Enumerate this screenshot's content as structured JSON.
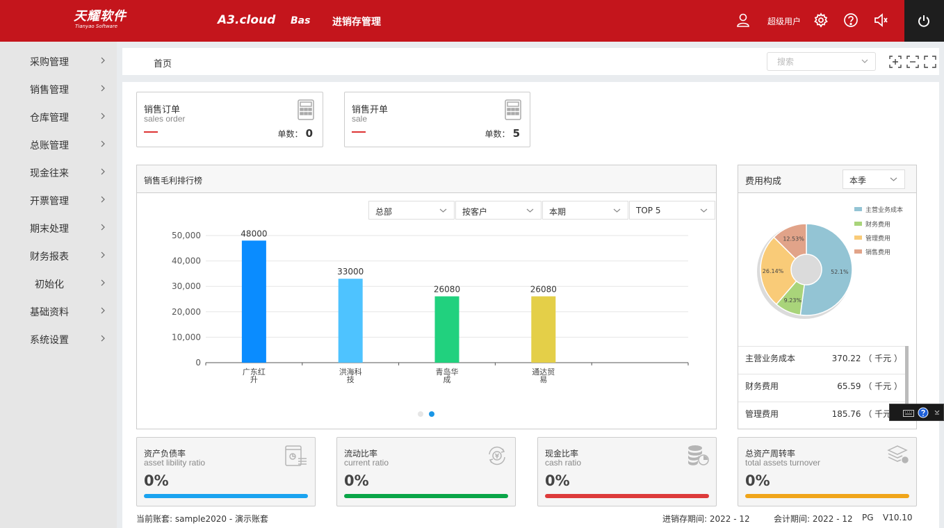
{
  "header": {
    "logo_cn": "天耀软件",
    "logo_en": "Tianyao Software",
    "nav": [
      "A3.cloud",
      "Bas",
      "进销存管理"
    ],
    "user_label": "超级用户",
    "icons": [
      "user-icon",
      "gear-icon",
      "help-icon",
      "speaker-icon",
      "power-icon"
    ]
  },
  "sidebar": {
    "items": [
      {
        "label": "采购管理"
      },
      {
        "label": "销售管理"
      },
      {
        "label": "仓库管理"
      },
      {
        "label": "总账管理"
      },
      {
        "label": "现金往来"
      },
      {
        "label": "开票管理"
      },
      {
        "label": "期末处理"
      },
      {
        "label": "财务报表"
      },
      {
        "label": "初始化"
      },
      {
        "label": "基础资料"
      },
      {
        "label": "系统设置"
      }
    ]
  },
  "breadcrumb": {
    "home": "首页"
  },
  "search": {
    "placeholder": "搜索"
  },
  "cards": [
    {
      "title": "销售订单",
      "subtitle": "sales order",
      "count_label": "单数：",
      "count": "0"
    },
    {
      "title": "销售开单",
      "subtitle": "sale",
      "count_label": "单数：",
      "count": "5"
    }
  ],
  "profit_panel": {
    "title": "销售毛利排行榜",
    "filters": [
      "总部",
      "按客户",
      "本期",
      "TOP 5"
    ]
  },
  "chart_data": {
    "type": "bar",
    "categories": [
      "广东红升",
      "洪海科技",
      "青岛华成",
      "通达贸易"
    ],
    "category_lines": [
      [
        "广东红",
        "升"
      ],
      [
        "洪海科",
        "技"
      ],
      [
        "青岛华",
        "成"
      ],
      [
        "通达贸",
        "易"
      ]
    ],
    "values": [
      48000,
      33000,
      26080,
      26080
    ],
    "data_labels": [
      "48000",
      "33000",
      "26080",
      "26080"
    ],
    "colors": [
      "#0a8cff",
      "#4ec3ff",
      "#21d17e",
      "#e4cf48"
    ],
    "yticks": [
      "0",
      "10,000",
      "20,000",
      "30,000",
      "40,000",
      "50,000"
    ],
    "ylim": [
      0,
      50000
    ],
    "slots": 5,
    "grid": true
  },
  "expense_panel": {
    "title": "费用构成",
    "period": "本季",
    "legend": [
      "主营业务成本",
      "财务费用",
      "管理费用",
      "销售费用"
    ],
    "pie": {
      "type": "pie",
      "labels": [
        "主营业务成本",
        "财务费用",
        "管理费用",
        "销售费用"
      ],
      "values": [
        52.1,
        9.23,
        26.14,
        12.53
      ],
      "slice_labels": [
        "52.1%",
        "9.23%",
        "26.14%",
        "12.53%"
      ],
      "colors": [
        "#93c4d4",
        "#a9d47a",
        "#f9cb78",
        "#e1a389"
      ]
    },
    "rows": [
      {
        "name": "主营业务成本",
        "value": "370.22 （ 千元 ）"
      },
      {
        "name": "财务费用",
        "value": "65.59 （ 千元 ）"
      },
      {
        "name": "管理费用",
        "value": "185.76 （ 千元 ）"
      }
    ]
  },
  "ratios": [
    {
      "title": "资产负债率",
      "subtitle": "asset libility ratio",
      "value": "0%",
      "color": "#1aa3f0"
    },
    {
      "title": "流动比率",
      "subtitle": "current ratio",
      "value": "0%",
      "color": "#0aa548"
    },
    {
      "title": "现金比率",
      "subtitle": "cash ratio",
      "value": "0%",
      "color": "#dd3b3b"
    },
    {
      "title": "总资产周转率",
      "subtitle": "total assets turnover",
      "value": "0%",
      "color": "#f0a51a"
    }
  ],
  "footer": {
    "account": "当前账套: sample2020 - 演示账套",
    "inv_period": "进销存期间: 2022 - 12",
    "acc_period": "会计期间: 2022 - 12",
    "db": "PG",
    "version": "V10.10"
  }
}
